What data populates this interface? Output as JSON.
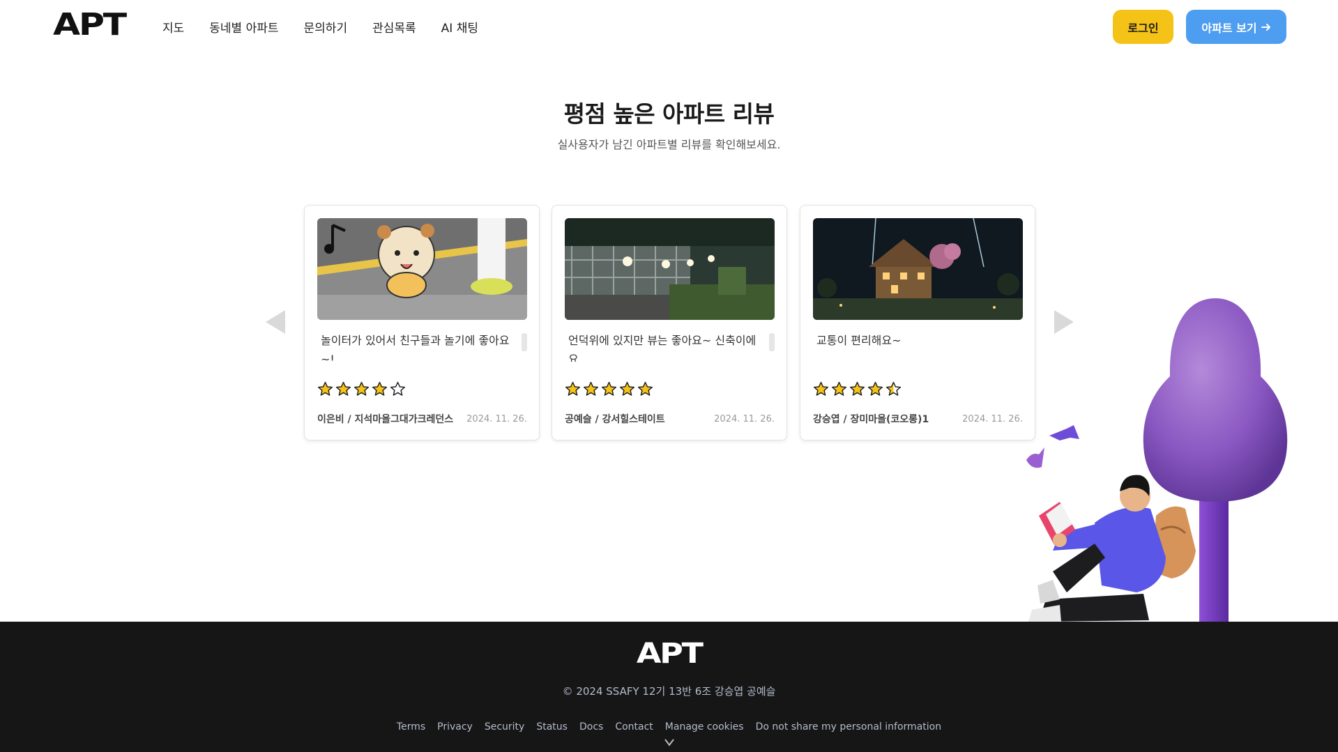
{
  "header": {
    "logo": "APT",
    "nav": [
      "지도",
      "동네별 아파트",
      "문의하기",
      "관심목록",
      "AI 채팅"
    ],
    "login_label": "로그인",
    "apt_button_label": "아파트 보기"
  },
  "section": {
    "title": "평점 높은 아파트 리뷰",
    "subtitle": "실사용자가 남긴 아파트별 리뷰를 확인해보세요."
  },
  "reviews": [
    {
      "text": "놀이터가 있어서 친구들과 놀기에 좋아요~!",
      "rating": 4,
      "author": "이은비 / 지석마을그대가크레던스",
      "date": "2024. 11. 26."
    },
    {
      "text": "언덕위에 있지만 뷰는 좋아요~ 신축이에요",
      "rating": 5,
      "author": "공예슬 / 강서힐스테이트",
      "date": "2024. 11. 26."
    },
    {
      "text": "교통이 편리해요~",
      "rating": 4.5,
      "author": "강승엽 / 장미마을(코오롱)1",
      "date": "2024. 11. 26."
    }
  ],
  "colors": {
    "login_bg": "#f5c317",
    "apt_button_bg": "#4d9df0",
    "star": "#f5c317",
    "footer_bg": "#161616"
  },
  "footer": {
    "logo": "APT",
    "copyright": "© 2024 SSAFY 12기 13반 6조 강승엽 공예슬",
    "links": [
      "Terms",
      "Privacy",
      "Security",
      "Status",
      "Docs",
      "Contact",
      "Manage cookies",
      "Do not share my personal information"
    ]
  }
}
